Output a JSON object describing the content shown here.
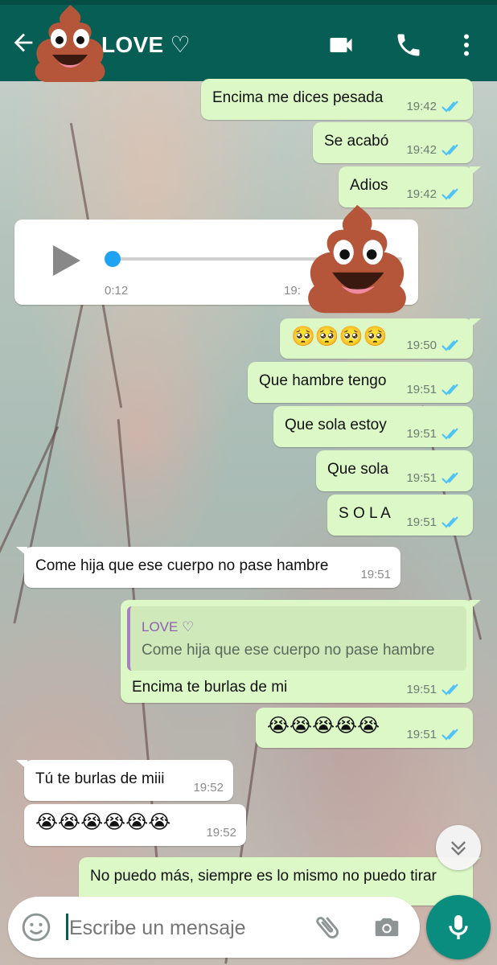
{
  "header": {
    "contact_name": "LOVE ♡",
    "video_call": "video-camera-icon",
    "voice_call": "phone-icon",
    "menu": "more-vert-icon",
    "color": "#075e54"
  },
  "messages": [
    {
      "dir": "out",
      "text": "Encima me dices pesada",
      "time": "19:42"
    },
    {
      "dir": "out",
      "text": "Se acabó",
      "time": "19:42"
    },
    {
      "dir": "out",
      "text": "Adios",
      "time": "19:42"
    },
    {
      "dir": "in",
      "type": "voice",
      "elapsed": "0:12",
      "time": "19:"
    },
    {
      "dir": "out",
      "type": "emoji",
      "emoji": "🥺🥺🥺🥺",
      "time": "19:50"
    },
    {
      "dir": "out",
      "text": "Que hambre tengo",
      "time": "19:51"
    },
    {
      "dir": "out",
      "text": "Que sola estoy",
      "time": "19:51"
    },
    {
      "dir": "out",
      "text": "Que sola",
      "time": "19:51"
    },
    {
      "dir": "out",
      "text": "S O L A",
      "time": "19:51"
    },
    {
      "dir": "in",
      "text": "Come hija que ese cuerpo no pase hambre",
      "time": "19:51"
    },
    {
      "dir": "out",
      "reply_to": {
        "name": "LOVE ♡",
        "text": "Come hija que ese cuerpo no pase hambre"
      },
      "text": "Encima te burlas de mi",
      "time": "19:51"
    },
    {
      "dir": "out",
      "type": "emoji",
      "emoji": "😭😭😭😭😭",
      "time": "19:51"
    },
    {
      "dir": "in",
      "text": "Tú te burlas de miii",
      "time": "19:52"
    },
    {
      "dir": "in",
      "type": "emoji",
      "emoji": "😭😭😭😭😭😭",
      "time": "19:52"
    },
    {
      "dir": "out",
      "text": "No puedo más, siempre es lo mismo no puedo tirar",
      "time": ""
    }
  ],
  "input": {
    "placeholder": "Escribe un mensaje",
    "emoji_button": "emoji-icon",
    "attach_button": "paperclip-icon",
    "camera_button": "camera-icon",
    "mic_button": "microphone-icon"
  },
  "colors": {
    "outgoing": "#dcf8c6",
    "incoming": "#ffffff",
    "ticks": "#4fc3f7",
    "accent": "#0a8d7e"
  }
}
